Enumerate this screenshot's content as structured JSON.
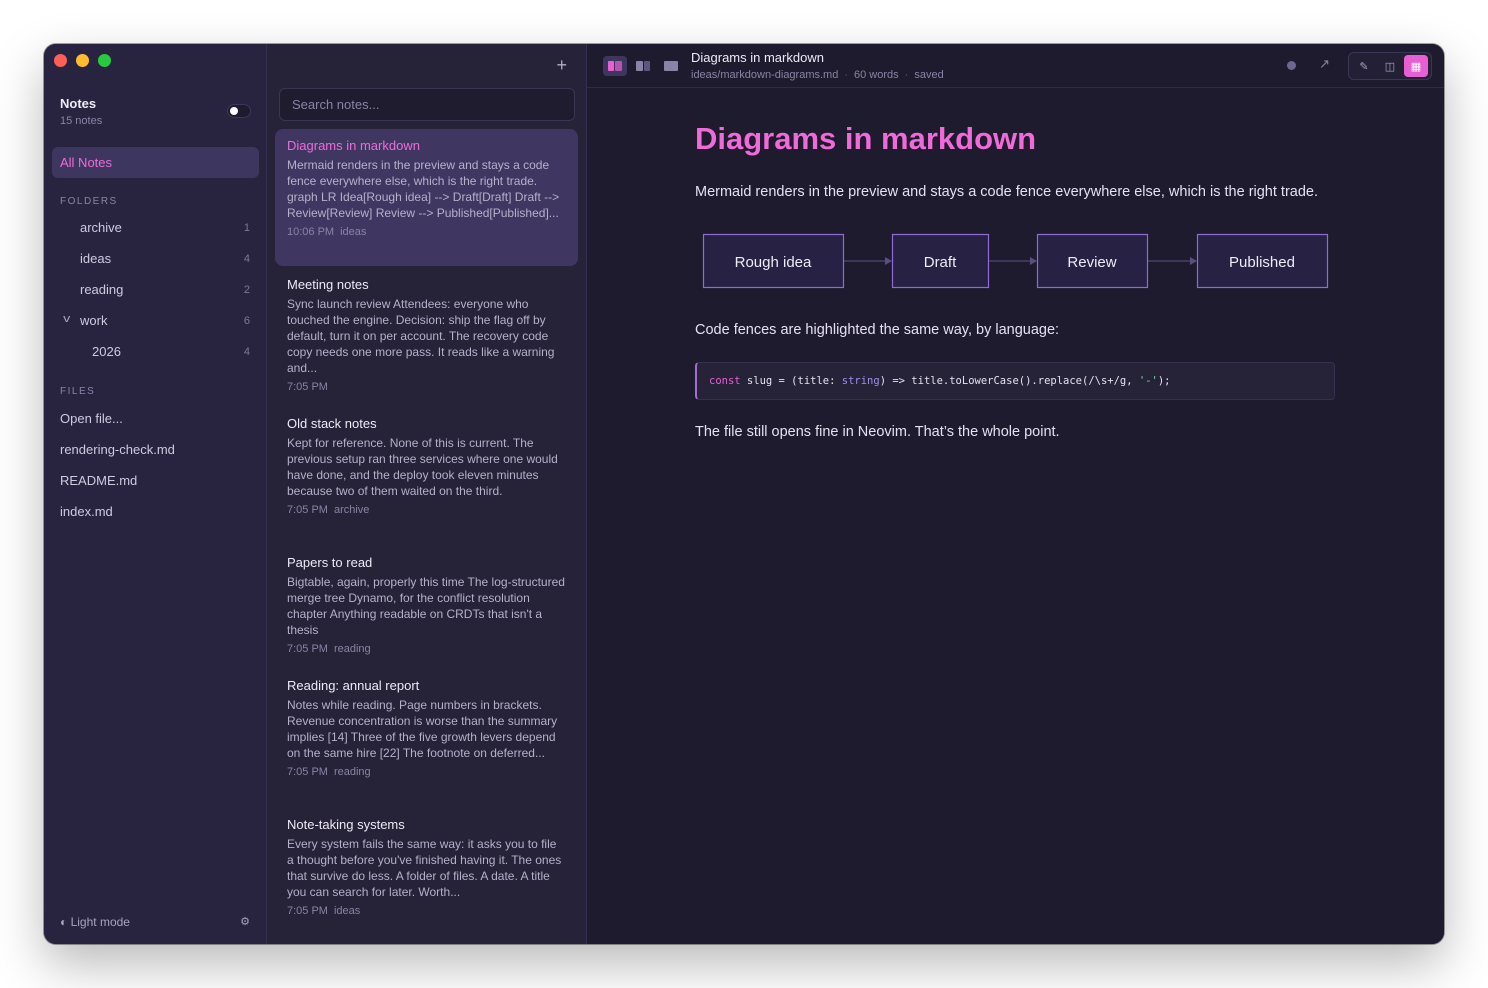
{
  "sidebar": {
    "title": "Notes",
    "count": "15 notes",
    "all_notes": "All Notes",
    "folders_heading": "FOLDERS",
    "folders": [
      {
        "label": "archive",
        "count": "1"
      },
      {
        "label": "ideas",
        "count": "4"
      },
      {
        "label": "reading",
        "count": "2"
      },
      {
        "label": "work",
        "count": "6"
      },
      {
        "label": "2026",
        "count": "4"
      }
    ],
    "files_heading": "FILES",
    "files": [
      "Open file...",
      "rendering-check.md",
      "README.md",
      "index.md"
    ],
    "light_mode": "Light mode",
    "toggle_on": true
  },
  "notes_list": {
    "search_placeholder": "Search notes...",
    "notes": [
      {
        "title": "Diagrams in markdown",
        "preview": "Mermaid renders in the preview and stays a code fence everywhere else, which is the right trade. graph LR Idea[Rough idea] --> Draft[Draft] Draft --> Review[Review] Review --> Published[Published]...",
        "time": "10:06 PM",
        "tag": "ideas"
      },
      {
        "title": "Meeting notes",
        "preview": "Sync launch review Attendees: everyone who touched the engine. Decision: ship the flag off by default, turn it on per account. The recovery code copy needs one more pass. It reads like a warning and...",
        "time": "7:05 PM",
        "tag": ""
      },
      {
        "title": "Old stack notes",
        "preview": "Kept for reference. None of this is current. The previous setup ran three services where one would have done, and the deploy took eleven minutes because two of them waited on the third.",
        "time": "7:05 PM",
        "tag": "archive"
      },
      {
        "title": "Papers to read",
        "preview": "Bigtable, again, properly this time The log-structured merge tree Dynamo, for the conflict resolution chapter Anything readable on CRDTs that isn't a thesis",
        "time": "7:05 PM",
        "tag": "reading"
      },
      {
        "title": "Reading: annual report",
        "preview": "Notes while reading. Page numbers in brackets. Revenue concentration is worse than the summary implies [14] Three of the five growth levers depend on the same hire [22] The footnote on deferred...",
        "time": "7:05 PM",
        "tag": "reading"
      },
      {
        "title": "Note-taking systems",
        "preview": "Every system fails the same way: it asks you to file a thought before you've finished having it. The ones that survive do less. A folder of files. A date. A title you can search for later. Worth...",
        "time": "7:05 PM",
        "tag": "ideas"
      }
    ]
  },
  "document": {
    "title": "Diagrams in markdown",
    "path": "ideas/markdown-diagrams.md",
    "words": "60 words",
    "status": "saved",
    "heading": "Diagrams in markdown",
    "intro": "Mermaid renders in the preview and stays a code fence everywhere else, which is the right trade.",
    "diagram_nodes": [
      "Rough idea",
      "Draft",
      "Review",
      "Published"
    ],
    "code_intro": "Code fences are highlighted the same way, by language:",
    "code": {
      "kw": "const",
      "a": " slug = (title: ",
      "ty": "string",
      "b": ") => title.toLowerCase().replace(/\\s+/g, ",
      "st": "'-'",
      "c": ");"
    },
    "outro": "The file still opens fine in Neovim. That’s the whole point."
  },
  "colors": {
    "accent": "#f06ad8",
    "background": "#1e1b2e",
    "sidebar": "#282440"
  }
}
